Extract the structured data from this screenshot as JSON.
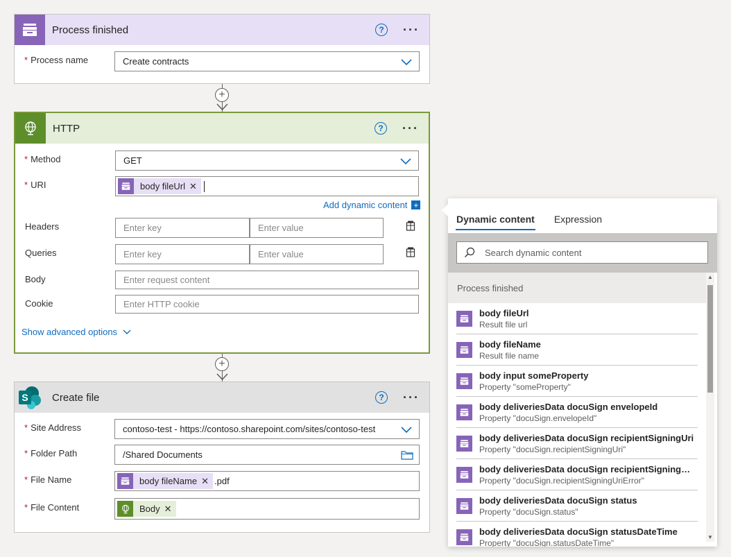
{
  "colors": {
    "purple": "#8764b8",
    "green": "#5d8e2a",
    "sharepoint": "#036c70",
    "blue": "#0f6cbd"
  },
  "card1": {
    "title": "Process finished",
    "icon": "archive-box-icon",
    "process_name_label": "Process name",
    "process_name_value": "Create contracts"
  },
  "card2": {
    "title": "HTTP",
    "icon": "globe-icon",
    "method_label": "Method",
    "method_value": "GET",
    "uri_label": "URI",
    "uri_token": "body fileUrl",
    "add_dynamic": "Add dynamic content",
    "headers_label": "Headers",
    "queries_label": "Queries",
    "key_placeholder": "Enter key",
    "value_placeholder": "Enter value",
    "body_label": "Body",
    "body_placeholder": "Enter request content",
    "cookie_label": "Cookie",
    "cookie_placeholder": "Enter HTTP cookie",
    "advanced": "Show advanced options"
  },
  "card3": {
    "title": "Create file",
    "icon": "sharepoint-icon",
    "site_label": "Site Address",
    "site_value": "contoso-test - https://contoso.sharepoint.com/sites/contoso-test",
    "folder_label": "Folder Path",
    "folder_value": "/Shared Documents",
    "filename_label": "File Name",
    "filename_token": "body fileName",
    "filename_suffix": ".pdf",
    "content_label": "File Content",
    "content_token": "Body"
  },
  "panel": {
    "tabs": [
      "Dynamic content",
      "Expression"
    ],
    "search_placeholder": "Search dynamic content",
    "group": "Process finished",
    "items": [
      {
        "title": "body fileUrl",
        "sub": "Result file url"
      },
      {
        "title": "body fileName",
        "sub": "Result file name"
      },
      {
        "title": "body input someProperty",
        "sub": "Property \"someProperty\""
      },
      {
        "title": "body deliveriesData docuSign envelopeId",
        "sub": "Property \"docuSign.envelopeId\""
      },
      {
        "title": "body deliveriesData docuSign recipientSigningUri",
        "sub": "Property \"docuSign.recipientSigningUri\""
      },
      {
        "title": "body deliveriesData docuSign recipientSigningUriError",
        "sub": "Property \"docuSign.recipientSigningUriError\""
      },
      {
        "title": "body deliveriesData docuSign status",
        "sub": "Property \"docuSign.status\""
      },
      {
        "title": "body deliveriesData docuSign statusDateTime",
        "sub": "Property \"docuSign.statusDateTime\""
      }
    ]
  }
}
